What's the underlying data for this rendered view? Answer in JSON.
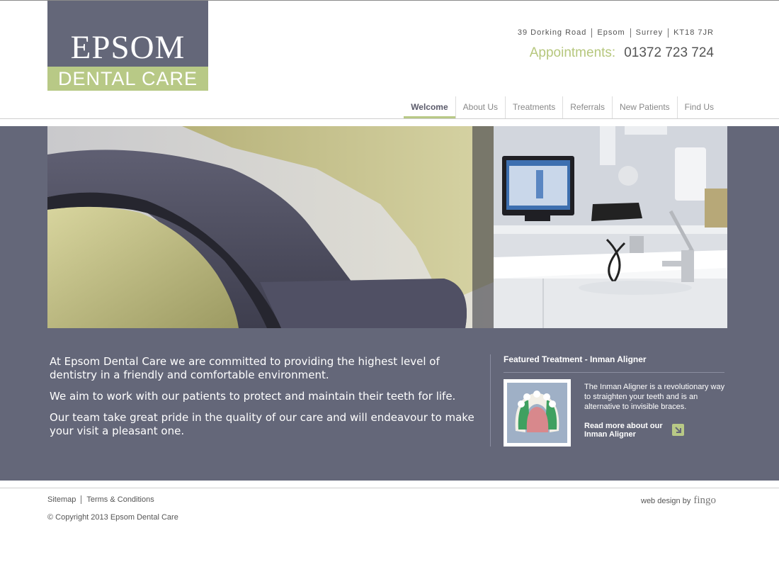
{
  "logo": {
    "line1": "EPSOM",
    "line2": "DENTAL CARE"
  },
  "header": {
    "address": [
      "39 Dorking Road",
      "Epsom",
      "Surrey",
      "KT18 7JR"
    ],
    "appointments_label": "Appointments:",
    "phone": "01372 723 724"
  },
  "nav": {
    "items": [
      {
        "label": "Welcome",
        "active": true
      },
      {
        "label": "About Us"
      },
      {
        "label": "Treatments"
      },
      {
        "label": "Referrals"
      },
      {
        "label": "New Patients"
      },
      {
        "label": "Find Us"
      }
    ]
  },
  "intro": {
    "paragraphs": [
      "At Epsom Dental Care we are committed to providing the highest level of dentistry in a friendly and comfortable environment.",
      "We aim to work with our patients to protect and maintain their teeth for life.",
      "Our team take great pride in the quality of our care and will endeavour to make your visit a pleasant one."
    ]
  },
  "featured": {
    "title": "Featured Treatment - Inman Aligner",
    "description": "The Inman Aligner is a revolutionary way to straighten your teeth and is an alternative to invisible braces.",
    "link": "Read more about our Inman Aligner"
  },
  "footer": {
    "links": [
      "Sitemap",
      "Terms & Conditions"
    ],
    "copyright": "© Copyright 2013 Epsom Dental Care",
    "webdesign": "web design by",
    "designer": "fingo"
  },
  "colors": {
    "brand_slate": "#646779",
    "brand_green": "#b8c986",
    "appointments_green": "#b6c77d"
  }
}
